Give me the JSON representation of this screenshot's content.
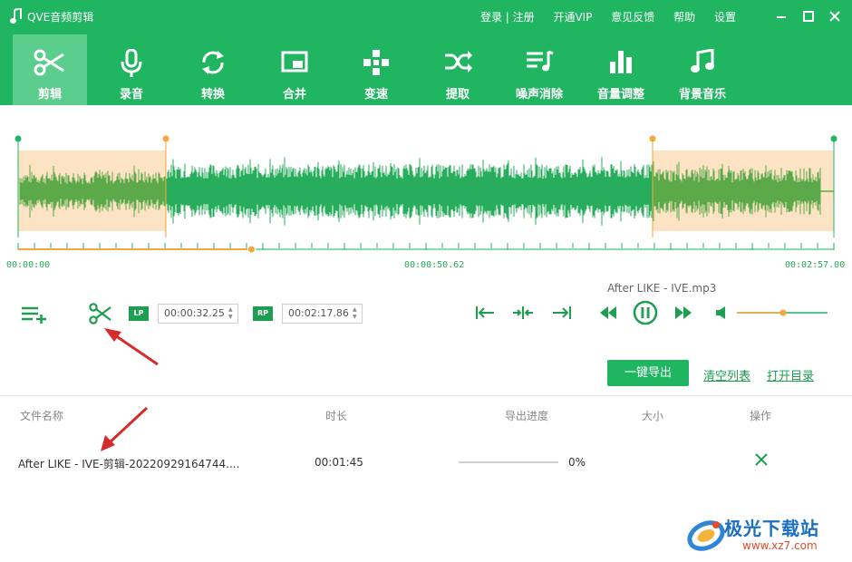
{
  "app": {
    "title": "QVE音频剪辑",
    "top_links": [
      "登录 | 注册",
      "开通VIP",
      "意见反馈",
      "帮助",
      "设置"
    ]
  },
  "toolbar": {
    "items": [
      {
        "label": "剪辑",
        "icon": "scissors-icon",
        "active": true
      },
      {
        "label": "录音",
        "icon": "microphone-icon"
      },
      {
        "label": "转换",
        "icon": "convert-icon"
      },
      {
        "label": "合并",
        "icon": "merge-icon"
      },
      {
        "label": "变速",
        "icon": "speed-icon"
      },
      {
        "label": "提取",
        "icon": "extract-icon"
      },
      {
        "label": "噪声消除",
        "icon": "noise-removal-icon"
      },
      {
        "label": "音量调整",
        "icon": "volume-adjust-icon"
      },
      {
        "label": "背景音乐",
        "icon": "music-note-icon"
      }
    ]
  },
  "timeline": {
    "start": "00:00:00",
    "middle": "00:00:50.62",
    "end": "00:02:57.00",
    "playhead_fraction": 0.286
  },
  "controls": {
    "lp_badge": "LP",
    "rp_badge": "RP",
    "lp_time": "00:00:32.25",
    "rp_time": "00:02:17.86",
    "current_file": "After LIKE - IVE.mp3",
    "volume_fraction": 0.51
  },
  "actions": {
    "export": "一键导出",
    "clear_list": "清空列表",
    "open_dir": "打开目录"
  },
  "table": {
    "headers": [
      "文件名称",
      "时长",
      "导出进度",
      "大小",
      "操作"
    ],
    "rows": [
      {
        "name": "After LIKE - IVE-剪辑-20220929164744....",
        "duration": "00:01:45",
        "progress_text": "0%",
        "progress": 0,
        "size": "",
        "action_icon": "delete-x-icon"
      }
    ]
  },
  "watermark": {
    "title": "极光下载站",
    "url": "www.xz7.com"
  },
  "colors": {
    "primary": "#1fb561",
    "active_tab": "#5bcd8c",
    "selection": "#fbe3c4",
    "marker": "#f4a73a",
    "annotation_arrow": "#d62b2b"
  }
}
